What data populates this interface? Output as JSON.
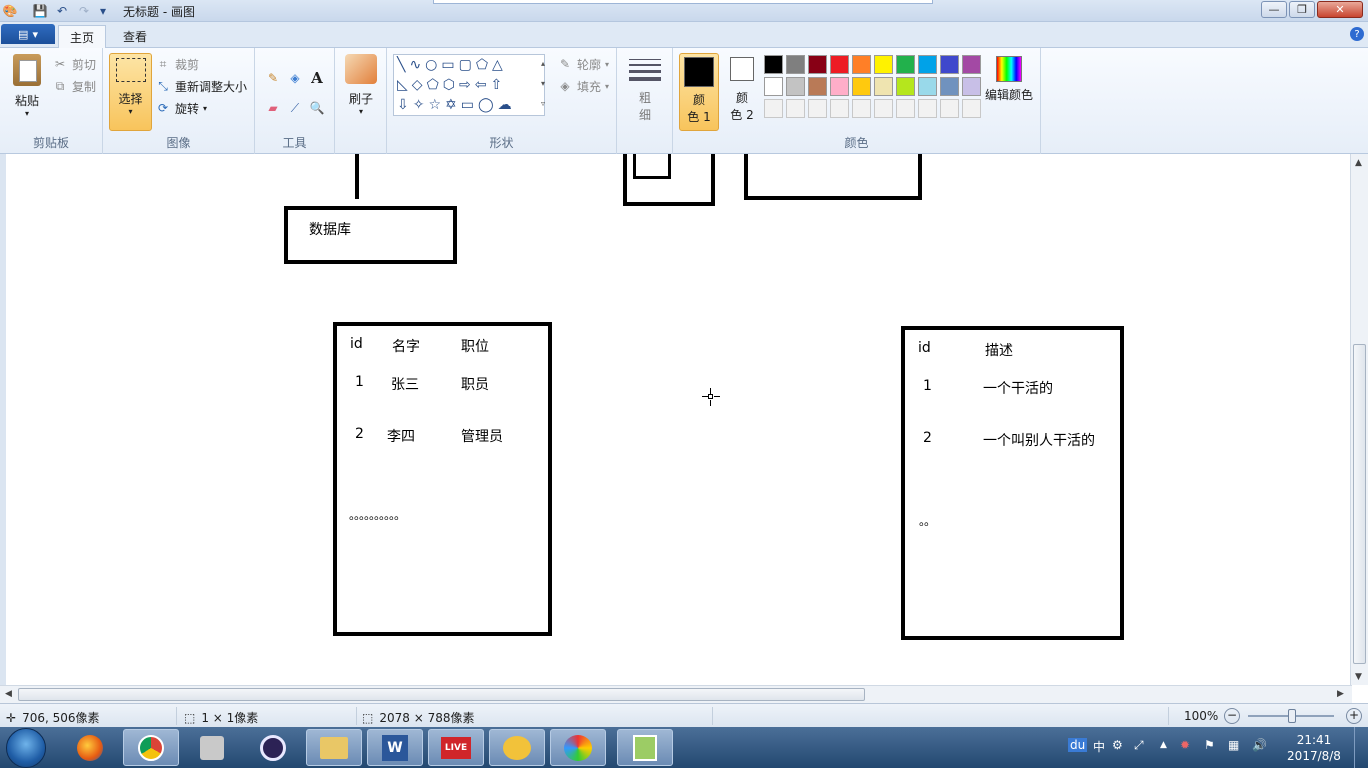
{
  "window": {
    "title": "无标题 - 画图",
    "controls": {
      "minimize": "—",
      "maximize": "❐",
      "close": "✕"
    }
  },
  "tabs": {
    "file_menu": "▾",
    "home": "主页",
    "view": "查看",
    "help": "?"
  },
  "ribbon": {
    "clipboard": {
      "paste": "粘贴",
      "cut": "剪切",
      "copy": "复制",
      "label": "剪贴板"
    },
    "image": {
      "select": "选择",
      "crop": "裁剪",
      "resize": "重新调整大小",
      "rotate": "旋转",
      "label": "图像"
    },
    "tools": {
      "label": "工具"
    },
    "brushes": {
      "label": "刷子"
    },
    "shapes": {
      "outline": "轮廓",
      "fill": "填充",
      "label": "形状"
    },
    "size": {
      "line1": "粗",
      "line2": "细"
    },
    "colors": {
      "color1_l1": "颜",
      "color1_l2": "色 1",
      "color2_l1": "颜",
      "color2_l2": "色 2",
      "edit": "编辑颜色",
      "label": "颜色",
      "palette_row1": [
        "#000000",
        "#7f7f7f",
        "#880015",
        "#ed1c24",
        "#ff7f27",
        "#fff200",
        "#22b14c",
        "#00a2e8",
        "#3f48cc",
        "#a349a4"
      ],
      "palette_row2": [
        "#ffffff",
        "#c3c3c3",
        "#b97a57",
        "#ffaec9",
        "#ffc90e",
        "#efe4b0",
        "#b5e61d",
        "#99d9ea",
        "#7092be",
        "#c8bfe7"
      ],
      "color1": "#000000",
      "color2": "#ffffff"
    }
  },
  "canvas": {
    "db_box": {
      "label": "数据库"
    },
    "table1": {
      "headers": [
        "id",
        "名字",
        "职位"
      ],
      "rows": [
        [
          "1",
          "张三",
          "职员"
        ],
        [
          "2",
          "李四",
          "管理员"
        ]
      ],
      "ellipsis": "。。。。。。。。。。"
    },
    "table2": {
      "headers": [
        "id",
        "描述"
      ],
      "rows": [
        [
          "1",
          "一个干活的"
        ],
        [
          "2",
          "一个叫别人干活的"
        ]
      ],
      "ellipsis": "。。"
    }
  },
  "statusbar": {
    "cursor_pos": "706, 506像素",
    "selection_size": "1 × 1像素",
    "image_size": "2078 × 788像素",
    "zoom": "100%"
  },
  "taskbar": {
    "ime": "中",
    "time": "21:41",
    "date": "2017/8/8"
  }
}
